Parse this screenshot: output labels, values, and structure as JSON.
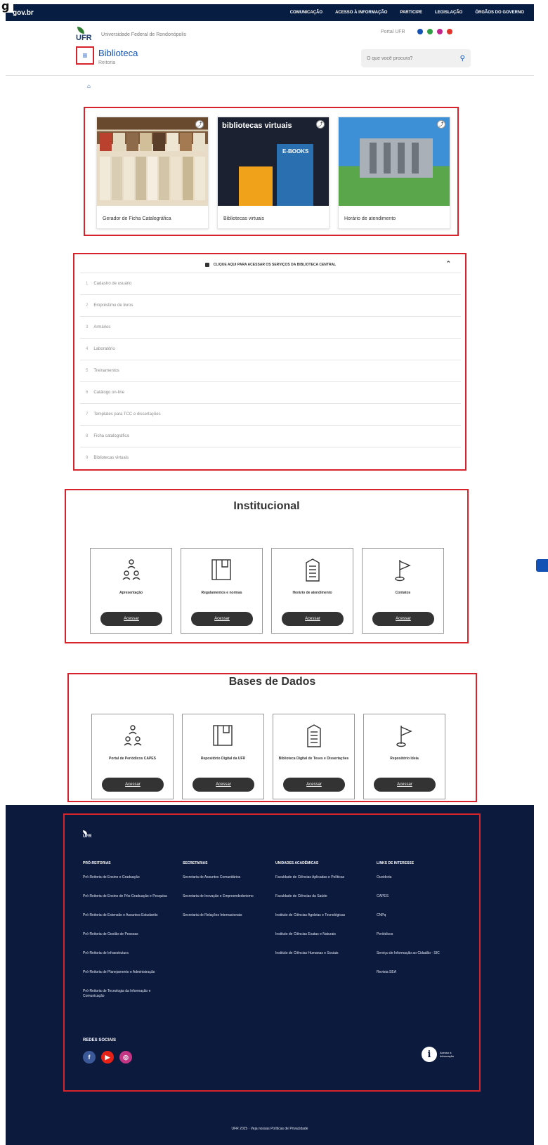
{
  "figure_label": "g",
  "govbar": {
    "brand": "gov.br",
    "links": [
      "COMUNICAÇÃO",
      "ACESSO À INFORMAÇÃO",
      "PARTICIPE",
      "LEGISLAÇÃO",
      "ÓRGÃOS DO GOVERNO"
    ]
  },
  "header": {
    "logo_text": "UFR",
    "university": "Universidade Federal de Rondonópolis",
    "portal_link": "Portal UFR",
    "site_title": "Biblioteca",
    "site_subtitle": "Reitoria",
    "search_placeholder": "O que você procura?"
  },
  "breadcrumb": "⌂",
  "cards": [
    {
      "caption": "Gerador de Ficha Catalográfica",
      "image_text": ""
    },
    {
      "caption": "Bibliotecas virtuais",
      "image_text": "bibliotecas virtuais",
      "image_badge": "E-BOOKS"
    },
    {
      "caption": "Horário de atendimento",
      "image_text": ""
    }
  ],
  "accordion": {
    "title": "CLIQUE AQUI PARA ACESSAR OS SERVIÇOS DA BIBLIOTECA CENTRAL",
    "items": [
      {
        "num": "1",
        "label": "Cadastro de usuário"
      },
      {
        "num": "2",
        "label": "Empréstimo de livros"
      },
      {
        "num": "3",
        "label": "Armários"
      },
      {
        "num": "4",
        "label": "Laboratório"
      },
      {
        "num": "5",
        "label": "Treinamentos"
      },
      {
        "num": "6",
        "label": "Catálogo on-line"
      },
      {
        "num": "7",
        "label": "Templates para TCC e dissertações"
      },
      {
        "num": "8",
        "label": "Ficha catalográfica"
      },
      {
        "num": "9",
        "label": "Bibliotecas virtuais"
      }
    ]
  },
  "institucional": {
    "title": "Institucional",
    "tiles": [
      {
        "label": "Apresentação",
        "button": "Acessar",
        "icon": "people-icon"
      },
      {
        "label": "Regulamentos e normas",
        "button": "Acessar",
        "icon": "book-icon"
      },
      {
        "label": "Horário de atendimento",
        "button": "Acessar",
        "icon": "building-icon"
      },
      {
        "label": "Contatos",
        "button": "Acessar",
        "icon": "flag-icon"
      }
    ]
  },
  "bases": {
    "title": "Bases de Dados",
    "tiles": [
      {
        "label": "Portal de Periódicos CAPES",
        "button": "Acessar",
        "icon": "people-icon"
      },
      {
        "label": "Repositório Digital da UFR",
        "button": "Acessar",
        "icon": "book-icon"
      },
      {
        "label": "Biblioteca Digital de Teses e Dissertações",
        "button": "Acessar",
        "icon": "building-icon"
      },
      {
        "label": "Repositório Ideia",
        "button": "Acessar",
        "icon": "flag-icon"
      }
    ]
  },
  "footer": {
    "logo_text": "UFR",
    "columns": [
      {
        "heading": "PRÓ-REITORIAS",
        "items": [
          "Pró-Reitoria de Ensino e Graduação",
          "Pró-Reitoria de Ensino de Pós-Graduação e Pesquisa",
          "Pró-Reitoria de Extensão e Assuntos Estudantis",
          "Pró-Reitoria de Gestão de Pessoas",
          "Pró-Reitoria de Infraestrutura",
          "Pró-Reitoria de Planejamento e Administração",
          "Pró-Reitoria de Tecnologia da Informação e Comunicação"
        ]
      },
      {
        "heading": "SECRETARIAS",
        "items": [
          "Secretaria de Assuntos Comunitários",
          "Secretaria de Inovação e Empreendedorismo",
          "Secretaria de Relações Internacionais"
        ]
      },
      {
        "heading": "UNIDADES ACADÊMICAS",
        "items": [
          "Faculdade de Ciências Aplicadas e Políticas",
          "Faculdade de Ciências da Saúde",
          "Instituto de Ciências Agrárias e Tecnológicas",
          "Instituto de Ciências Exatas e Naturais",
          "Instituto de Ciências Humanas e Sociais"
        ]
      },
      {
        "heading": "LINKS DE INTERESSE",
        "items": [
          "Ouvidoria",
          "CAPES",
          "CNPq",
          "Periódicos",
          "Serviço de Informação ao Cidadão - SIC",
          "Revista SEA"
        ]
      }
    ],
    "social_title": "REDES SOCIAIS",
    "social": [
      {
        "glyph": "f",
        "color": "#3b5998"
      },
      {
        "glyph": "▶",
        "color": "#e62117"
      },
      {
        "glyph": "◎",
        "color": "#c13584"
      }
    ],
    "info_label": "Acesso à Informação",
    "copyright": "UFR 2025 · Veja nossas Políticas de Privacidade"
  },
  "colors": {
    "accent": "#1351b4",
    "highlight": "#d6232c",
    "footer_bg": "#0c1a3e",
    "gov_bar": "#071d41"
  }
}
